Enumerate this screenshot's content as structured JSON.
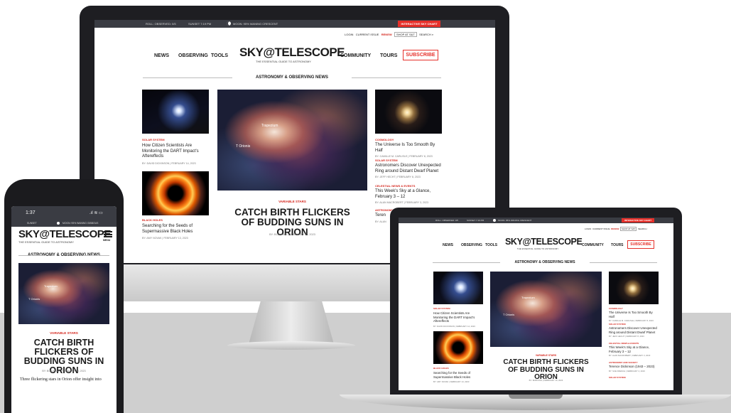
{
  "topbar": {
    "roll": "ROLL: OBSERVED: 0/5",
    "sunset": "SUNSET 7:19 PM",
    "moon": "MOON: 95% WANING CRESCENT",
    "chart_button": "INTERACTIVE SKY CHART"
  },
  "utility": {
    "login": "LOGIN",
    "current_issue": "CURRENT ISSUE",
    "renew": "RENEW",
    "shop": "SHOP AT S&T",
    "search": "SEARCH"
  },
  "phone_status": {
    "time": "1:37",
    "sunset": "SUNSET",
    "moon": "MOON: 95% WANING GIBBOUS"
  },
  "nav": {
    "news": "NEWS",
    "observing": "OBSERVING",
    "tools": "TOOLS",
    "community": "COMMUNITY",
    "tours": "TOURS",
    "subscribe": "SUBSCRIBE",
    "menu": "MENU"
  },
  "logo": {
    "name": "SKY@TELESCOPE",
    "tagline": "THE ESSENTIAL GUIDE TO ASTRONOMY"
  },
  "section_title": "ASTRONOMY & OBSERVING NEWS",
  "feature": {
    "category": "VARIABLE STARS",
    "headline": "CATCH BIRTH FLICKERS OF BUDDING SUNS IN ORION",
    "byline": "BY: BOB KING | FEBRUARY 10, 2023",
    "excerpt": "Three flickering stars in Orion offer insight into",
    "img_label_1": "Trapezium",
    "img_label_2": "T Orionis",
    "img_label_3": "T Orionis"
  },
  "left_articles": [
    {
      "category": "SOLAR SYSTEM",
      "title": "How Citizen Scientists Are Monitoring the DART Impact's Aftereffects",
      "byline": "BY: DAVID DICKINSON | FEBRUARY 14, 2023"
    },
    {
      "category": "BLACK HOLES",
      "title": "Searching for the Seeds of Supermassive Black Holes",
      "byline": "BY: AMY NOVAK | FEBRUARY 13, 2023"
    }
  ],
  "right_articles": [
    {
      "category": "COSMOLOGY",
      "title": "The Universe Is Too Smooth By Half",
      "byline": "BY: CAMILLE M. CARLISLE | FEBRUARY 8, 2023"
    },
    {
      "category": "SOLAR SYSTEM",
      "title": "Astronomers Discover Unexpected Ring around Distant Dwarf Planet",
      "byline": "BY: JEFF HECHT | FEBRUARY 8, 2023"
    },
    {
      "category": "CELESTIAL NEWS & EVENTS",
      "title": "This Week's Sky at a Glance, February 3 – 12",
      "byline": "BY: ALAN MACROBERT | FEBRUARY 3, 2023"
    },
    {
      "category": "ASTRONOMY AND SOCIETY",
      "title": "Terence Dickinson (1943 – 2023)",
      "byline": "BY: SUE FRENCH | FEBRUARY 4, 2023"
    },
    {
      "category": "SOLAR SYSTEM",
      "title": "Teren",
      "byline": "BY: ALAN"
    }
  ]
}
